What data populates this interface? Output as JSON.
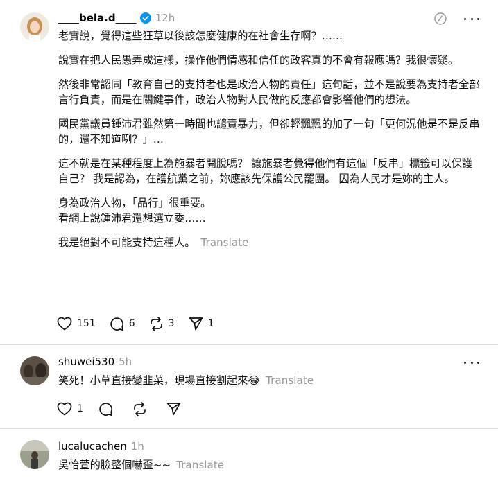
{
  "main_post": {
    "username": "____bela.d____",
    "time": "12h",
    "paragraphs": [
      "老實說，覺得這些狂草以後該怎麼健康的在社會生存啊？……",
      "說實在把人民愚弄成這樣，操作他們情感和信任的政客真的不會有報應嗎？我很懷疑。",
      "然後非常認同「教育自己的支持者也是政治人物的責任」這句話，並不是說要為支持者全部言行負責，而是在關鍵事件，政治人物對人民做的反應都會影響他們的想法。",
      "國民黨議員鍾沛君雖然第一時間也譴責暴力，但卻輕飄飄的加了一句「更何況他是不是反串的，還不知道咧？」…",
      "這不就是在某種程度上為施暴者開脫嗎？ 讓施暴者覺得他們有這個「反串」標籤可以保護自己？ 我是認為，在護航黨之前，妳應該先保護公民罷團。 因為人民才是妳的主人。",
      "身為政治人物，「品行」很重要。",
      "看網上說鍾沛君還想選立委……",
      "我是絕對不可能支持這種人。"
    ],
    "translate": "Translate",
    "likes": "151",
    "comments": "6",
    "reposts": "3",
    "shares": "1"
  },
  "replies": [
    {
      "username": "shuwei530",
      "time": "5h",
      "text": "笑死！小草直接變韭菜，現場直接割起來😂",
      "translate": "Translate",
      "likes": "1"
    },
    {
      "username": "lucalucachen",
      "time": "1h",
      "text": "吳怡萱的臉整個嚇歪~~",
      "translate": "Translate"
    }
  ],
  "colors": {
    "verified": "#0095f6",
    "muted": "#999999",
    "divider": "#e0e0e0"
  },
  "icons": [
    "heart-icon",
    "comment-icon",
    "repost-icon",
    "share-icon",
    "more-icon",
    "edit-icon",
    "verified-icon"
  ]
}
